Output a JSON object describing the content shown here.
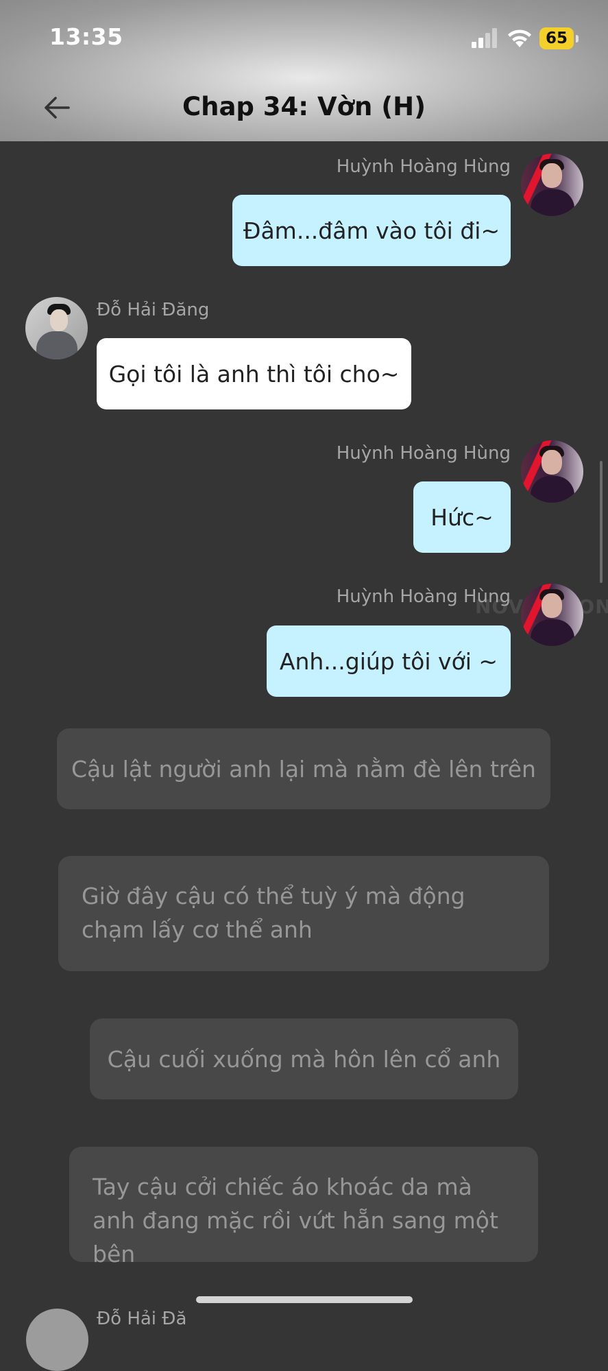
{
  "status_bar": {
    "time": "13:35",
    "battery": "65",
    "signal_bars_active": 2,
    "signal_bars_total": 4
  },
  "header": {
    "title": "Chap 34: Vờn (H)",
    "back_icon": "arrow-left-icon"
  },
  "messages": [
    {
      "sender": "Huỳnh Hoàng Hùng",
      "text": "Đâm...đâm vào tôi đi~"
    },
    {
      "sender": "Đỗ Hải Đăng",
      "text": "Gọi tôi là anh thì tôi cho~"
    },
    {
      "sender": "Huỳnh Hoàng Hùng",
      "text": "Hức~"
    },
    {
      "sender": "Huỳnh Hoàng Hùng",
      "text": "Anh...giúp tôi với ~"
    }
  ],
  "choices": [
    "Cậu lật người anh lại mà nằm đè lên trên",
    "Giờ đây cậu có thể tuỳ ý mà động chạm lấy cơ thể anh",
    "Cậu cuối xuống mà hôn lên cổ anh",
    "Tay cậu cởi chiếc áo khoác da mà anh đang mặc rồi vứt hẵn sang một bên"
  ],
  "next_sender_partial": "Đỗ Hải Đă",
  "watermark": "NOVELTOON",
  "colors": {
    "background": "#353535",
    "bubble_own": "#c6f1ff",
    "bubble_other": "#ffffff",
    "choice_bg": "#484848",
    "choice_text": "#979797",
    "battery": "#f5d02a"
  }
}
